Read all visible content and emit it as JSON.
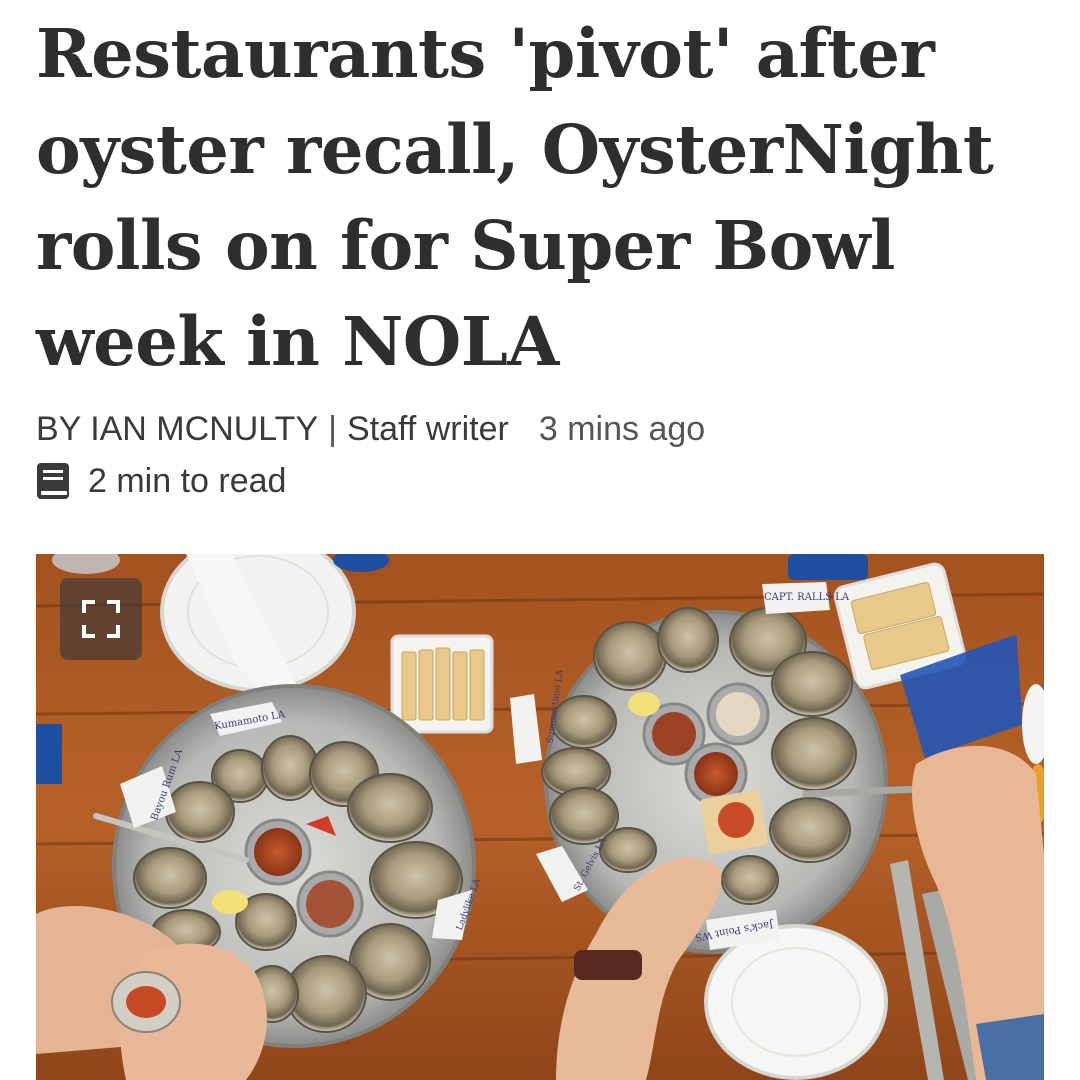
{
  "article": {
    "headline": "Restaurants 'pivot' after oyster recall, OysterNight rolls on for Super Bowl week in NOLA",
    "byline": "BY IAN MCNULTY",
    "separator": "|",
    "role": "Staff writer",
    "time_ago": "3 mins ago",
    "read_time": "2 min to read",
    "read_icon": "book-icon"
  },
  "photo": {
    "expand_icon": "expand-icon",
    "tags": {
      "kumamoto": "Kumamoto LA",
      "bayou": "Bayou Rum LA",
      "capt": "CAPT. RALLS LA",
      "summertime": "Summertime LA",
      "ladylike": "Ladylike LA",
      "jacks": "Jack's Point WS",
      "gelvis": "St. Gelvis LA"
    }
  }
}
